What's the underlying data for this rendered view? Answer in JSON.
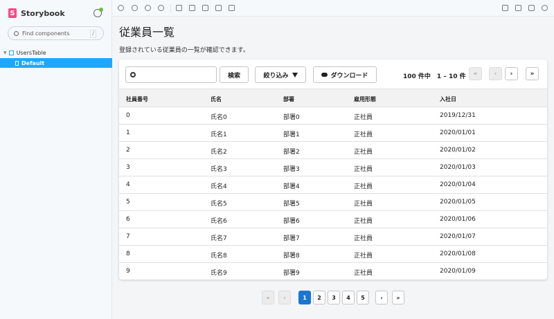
{
  "sidebar": {
    "brand": "Storybook",
    "search_placeholder": "Find components",
    "search_shortcut": "/",
    "group": "UsersTable",
    "story": "Default"
  },
  "page": {
    "title": "従業員一覧",
    "description": "登録されている従業員の一覧が確認できます。"
  },
  "toolbar": {
    "search_button": "検索",
    "filter_button": "絞り込み",
    "download_button": "ダウンロード",
    "range_text": "100 件中　1 – 10 件",
    "first": "«",
    "prev": "‹",
    "next": "›",
    "last": "»"
  },
  "table": {
    "headers": [
      "社員番号",
      "氏名",
      "部署",
      "雇用形態",
      "入社日"
    ],
    "rows": [
      [
        "0",
        "氏名0",
        "部署0",
        "正社員",
        "2019/12/31"
      ],
      [
        "1",
        "氏名1",
        "部署1",
        "正社員",
        "2020/01/01"
      ],
      [
        "2",
        "氏名2",
        "部署2",
        "正社員",
        "2020/01/02"
      ],
      [
        "3",
        "氏名3",
        "部署3",
        "正社員",
        "2020/01/03"
      ],
      [
        "4",
        "氏名4",
        "部署4",
        "正社員",
        "2020/01/04"
      ],
      [
        "5",
        "氏名5",
        "部署5",
        "正社員",
        "2020/01/05"
      ],
      [
        "6",
        "氏名6",
        "部署6",
        "正社員",
        "2020/01/06"
      ],
      [
        "7",
        "氏名7",
        "部署7",
        "正社員",
        "2020/01/07"
      ],
      [
        "8",
        "氏名8",
        "部署8",
        "正社員",
        "2020/01/08"
      ],
      [
        "9",
        "氏名9",
        "部署9",
        "正社員",
        "2020/01/09"
      ]
    ]
  },
  "pagination": {
    "pages": [
      "1",
      "2",
      "3",
      "4",
      "5"
    ],
    "current_page": "1"
  },
  "colors": {
    "accent": "#1ea7fd",
    "brand": "#ff4785",
    "active_page": "#1976d2"
  }
}
